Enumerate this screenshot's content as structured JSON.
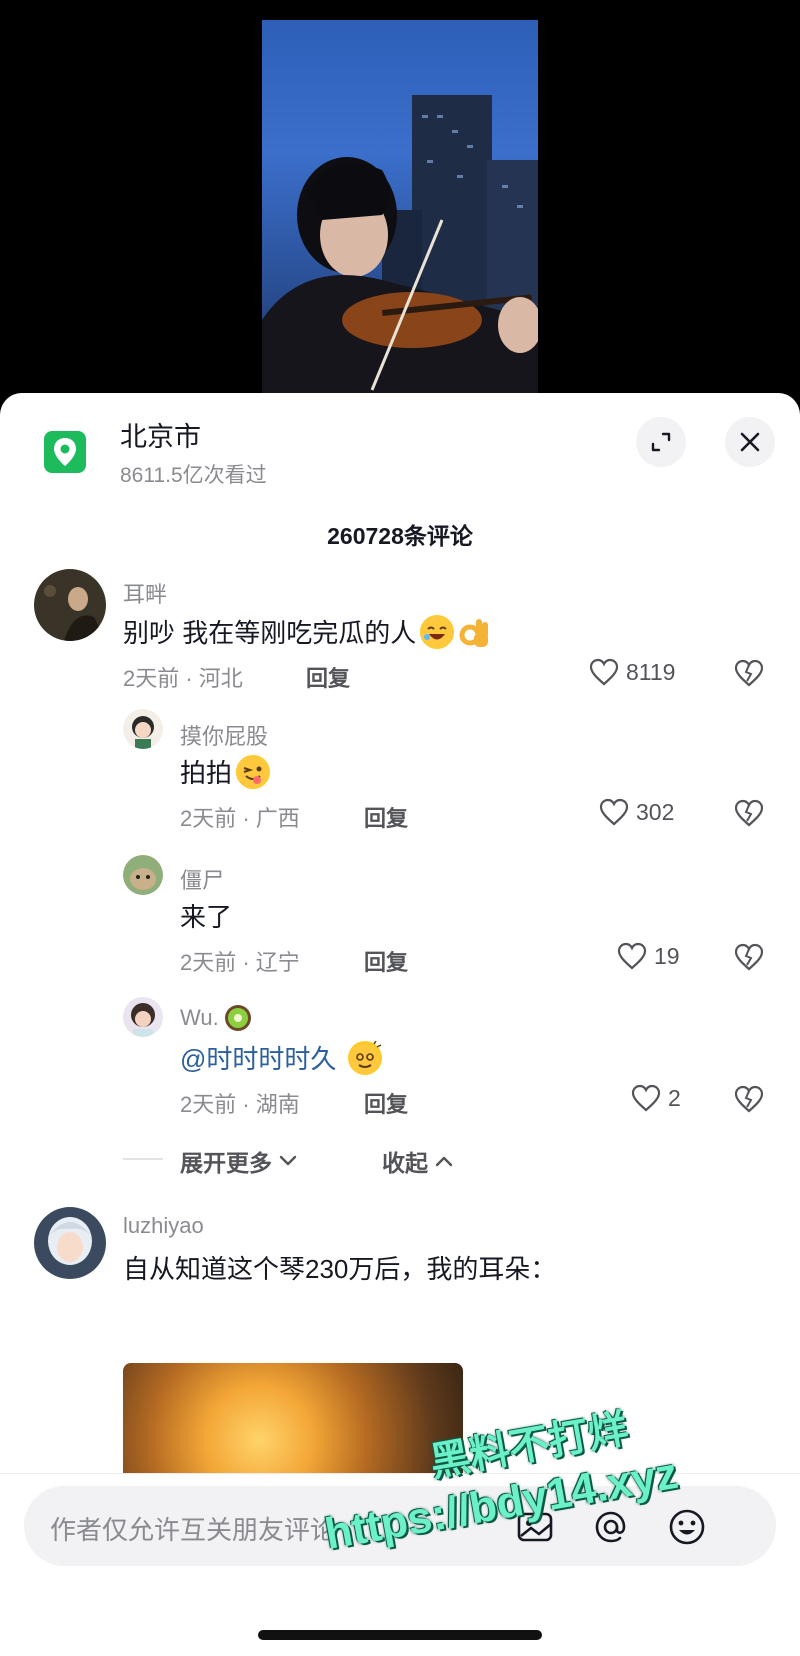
{
  "location": {
    "title": "北京市",
    "views": "8611.5亿次看过"
  },
  "comment_count": "260728条评论",
  "comments": [
    {
      "name": "耳畔",
      "text": "别吵 我在等刚吃完瓜的人",
      "meta": "2天前 · 河北",
      "reply": "回复",
      "likes": "8119"
    },
    {
      "name": "摸你屁股",
      "text": "拍拍",
      "meta": "2天前 · 广西",
      "reply": "回复",
      "likes": "302"
    },
    {
      "name": "僵尸",
      "text": "来了",
      "meta": "2天前 · 辽宁",
      "reply": "回复",
      "likes": "19"
    },
    {
      "name": "Wu.",
      "text": "@时时时时久",
      "meta": "2天前 · 湖南",
      "reply": "回复",
      "likes": "2"
    },
    {
      "name": "luzhiyao",
      "text": "自从知道这个琴230万后，我的耳朵："
    }
  ],
  "expand_more": "展开更多",
  "collapse": "收起",
  "input": {
    "placeholder": "作者仅允许互关朋友评论"
  },
  "watermark": {
    "line1": "黑料不打烊",
    "line2": "https://bdy14.xyz"
  },
  "colors": {
    "accent_green": "#1dbb5c",
    "mention_blue": "#2b5f9e",
    "watermark": "#6bf0c8"
  }
}
